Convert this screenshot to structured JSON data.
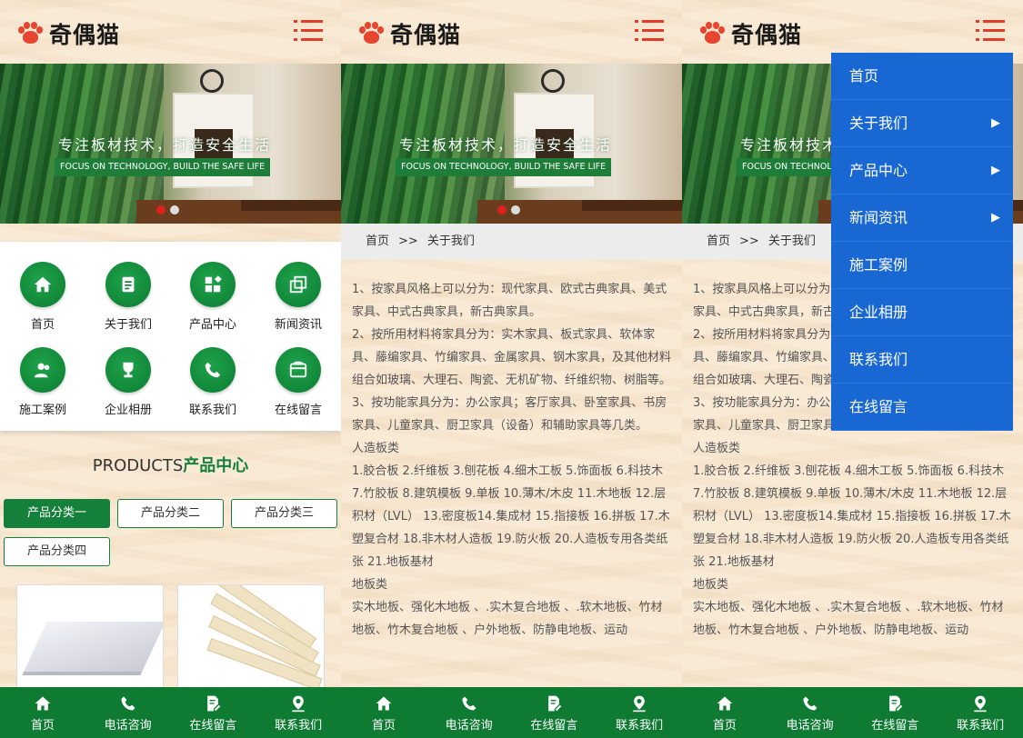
{
  "brand": {
    "name": "奇偶猫"
  },
  "banner": {
    "slogan": "专注板材技术，打造安全生活",
    "slogan_en": "FOCUS ON TECHNOLOGY, BUILD THE SAFE LIFE"
  },
  "icon_grid": [
    {
      "label": "首页",
      "icon": "home-icon"
    },
    {
      "label": "关于我们",
      "icon": "document-icon"
    },
    {
      "label": "产品中心",
      "icon": "grid-icon"
    },
    {
      "label": "新闻资讯",
      "icon": "copy-icon"
    },
    {
      "label": "施工案例",
      "icon": "people-icon"
    },
    {
      "label": "企业相册",
      "icon": "trophy-icon"
    },
    {
      "label": "联系我们",
      "icon": "phone-icon"
    },
    {
      "label": "在线留言",
      "icon": "message-icon"
    }
  ],
  "products": {
    "title_en": "PRODUCTS",
    "title_cn": "产品中心",
    "categories": [
      "产品分类一",
      "产品分类二",
      "产品分类三",
      "产品分类四"
    ],
    "active_category": "产品分类一"
  },
  "breadcrumb": {
    "home": "首页",
    "sep": ">>",
    "current": "关于我们"
  },
  "article": {
    "p1": "1、按家具风格上可以分为：现代家具、欧式古典家具、美式家具、中式古典家具，新古典家具。",
    "p2": "2、按所用材料将家具分为：实木家具、板式家具、软体家具、藤编家具、竹编家具、金属家具、钢木家具，及其他材料组合如玻璃、大理石、陶瓷、无机矿物、纤维织物、树脂等。",
    "p3": "3、按功能家具分为：办公家具；客厅家具、卧室家具、书房家具、儿童家具、厨卫家具（设备）和辅助家具等几类。",
    "h1": "人造板类",
    "p4": "1.胶合板 2.纤维板 3.刨花板 4.细木工板 5.饰面板 6.科技木 7.竹胶板 8.建筑模板 9.单板 10.薄木/木皮 11.木地板 12.层积材（LVL） 13.密度板14.集成材 15.指接板 16.拼板 17.木塑复合材 18.非木材人造板 19.防火板 20.人造板专用各类纸张 21.地板基材",
    "h2": "地板类",
    "p5": "实木地板、强化木地板 、.实木复合地板 、.软木地板、竹材地板、竹木复合地板 、户外地板、防静电地板、运动"
  },
  "dropdown": [
    {
      "label": "首页",
      "has_sub": false
    },
    {
      "label": "关于我们",
      "has_sub": true
    },
    {
      "label": "产品中心",
      "has_sub": true
    },
    {
      "label": "新闻资讯",
      "has_sub": true
    },
    {
      "label": "施工案例",
      "has_sub": false
    },
    {
      "label": "企业相册",
      "has_sub": false
    },
    {
      "label": "联系我们",
      "has_sub": false
    },
    {
      "label": "在线留言",
      "has_sub": false
    }
  ],
  "dropdown_arrow": "▶",
  "bottom_nav": [
    {
      "label": "首页",
      "icon": "home-icon"
    },
    {
      "label": "电话咨询",
      "icon": "phone-icon"
    },
    {
      "label": "在线留言",
      "icon": "edit-icon"
    },
    {
      "label": "联系我们",
      "icon": "location-icon"
    }
  ],
  "colors": {
    "green": "#15803c",
    "nav_green": "#0e7a32",
    "menu_blue": "#1967d2",
    "accent_red": "#e23b2a"
  }
}
